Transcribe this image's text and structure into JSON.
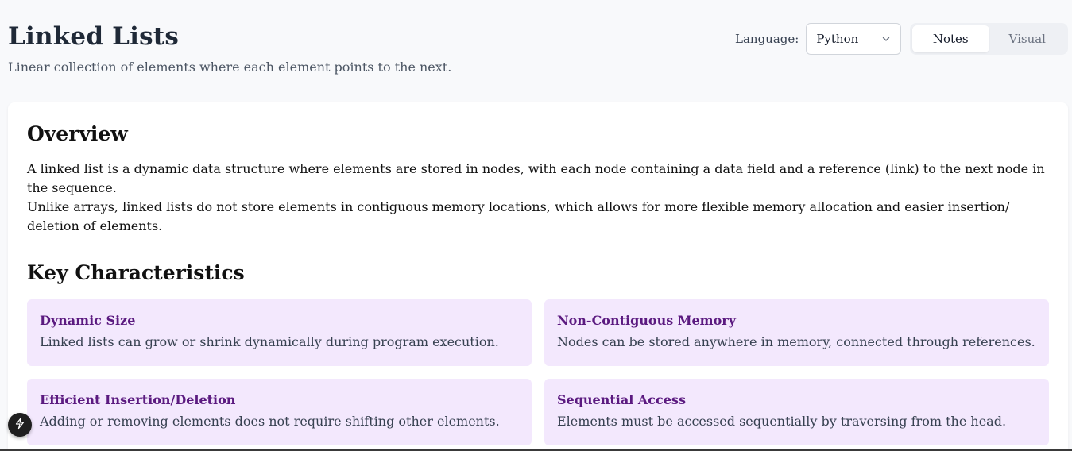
{
  "header": {
    "title": "Linked Lists",
    "subtitle": "Linear collection of elements where each element points to the next."
  },
  "language": {
    "label": "Language:",
    "selected": "Python"
  },
  "view_toggle": {
    "notes": "Notes",
    "visual": "Visual",
    "active": "Notes"
  },
  "overview": {
    "heading": "Overview",
    "paragraph1": "A linked list is a dynamic data structure where elements are stored in nodes, with each node containing a data field and a reference (link) to the next node in the sequence.",
    "paragraph2": "Unlike arrays, linked lists do not store elements in contiguous memory locations, which allows for more flexible memory allocation and easier insertion/ deletion of elements."
  },
  "key_characteristics": {
    "heading": "Key Characteristics",
    "items": [
      {
        "title": "Dynamic Size",
        "description": "Linked lists can grow or shrink dynamically during program execution."
      },
      {
        "title": "Non-Contiguous Memory",
        "description": "Nodes can be stored anywhere in memory, connected through references."
      },
      {
        "title": "Efficient Insertion/Deletion",
        "description": "Adding or removing elements does not require shifting other elements."
      },
      {
        "title": "Sequential Access",
        "description": "Elements must be accessed sequentially by traversing from the head."
      }
    ]
  },
  "colors": {
    "accent_bg": "#f3e8fd",
    "accent_text": "#5b1a80"
  },
  "icons": {
    "select": "chevron-down-icon",
    "fab": "bolt-icon"
  }
}
